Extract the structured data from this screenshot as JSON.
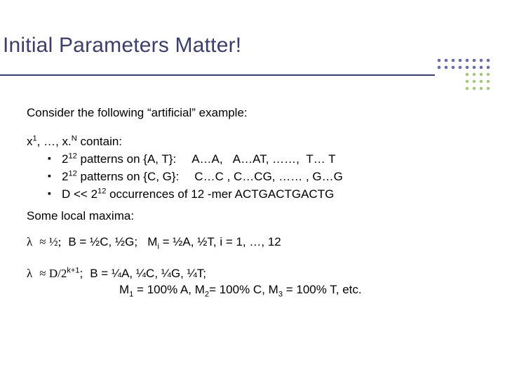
{
  "title": "Initial Parameters Matter!",
  "intro": "Consider the following “artificial” example:",
  "contain": {
    "prefix1": "x",
    "sup1": "1",
    "mid": ", …, x.",
    "supN": "N",
    "suffix": " contain:"
  },
  "bullets": [
    {
      "lead": "2",
      "sup": "12",
      "rest": " patterns on {A, T}:",
      "tail": "A…A,   A…AT, ……,  T… T"
    },
    {
      "lead": "2",
      "sup": "12",
      "rest": " patterns on {C, G}:",
      "tail": "C…C , C…CG, …… , G…G"
    },
    {
      "lead": "D << 2",
      "sup": "12",
      "rest": " occurrences of 12 -mer ACTGACTGACTG",
      "tail": ""
    }
  ],
  "maxima_label": "Some local maxima:",
  "row1": {
    "lambda": "λ",
    "approx": "≈ ½;",
    "rest": "B = ½C, ½G;   M",
    "isub": "i",
    "tail": " = ½A, ½T, i = 1, …, 12"
  },
  "row2": {
    "lambda": "λ",
    "approx": "≈ D/2",
    "sup": "k+1",
    "semi": ";",
    "btext": "B = ¼A, ¼C, ¼G, ¼T;",
    "line2_a": "M",
    "line2_a_sub": "1",
    "line2_a_tail": " = 100% A, M",
    "line2_b_sub": "2",
    "line2_b_tail": "= 100% C, M",
    "line2_c_sub": "3",
    "line2_c_tail": " = 100% T, etc."
  }
}
